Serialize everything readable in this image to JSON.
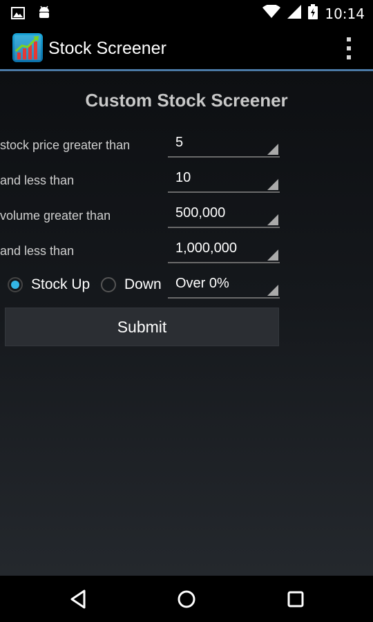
{
  "status_bar": {
    "time": "10:14",
    "icons": [
      "image-icon",
      "android-icon",
      "wifi-icon",
      "signal-icon",
      "battery-charging-icon"
    ]
  },
  "app_bar": {
    "title": "Stock Screener",
    "app_icon": "stock-chart-icon",
    "overflow_icon": "overflow-menu-icon"
  },
  "screener": {
    "title": "Custom Stock Screener",
    "rows": [
      {
        "label": "stock price greater than",
        "value": "5"
      },
      {
        "label": "and less than",
        "value": "10"
      },
      {
        "label": "volume greater than",
        "value": "500,000"
      },
      {
        "label": "and less than",
        "value": "1,000,000"
      }
    ],
    "direction": {
      "options": [
        {
          "label": "Stock Up",
          "selected": true
        },
        {
          "label": "Down",
          "selected": false
        }
      ],
      "threshold_value": "Over 0%"
    },
    "submit_label": "Submit"
  },
  "nav_bar": {
    "icons": [
      "back-icon",
      "home-icon",
      "recents-icon"
    ]
  },
  "colors": {
    "accent": "#33b5e5",
    "action_bar_divider": "#4b7aa6",
    "button_bg": "#2b2e33"
  }
}
